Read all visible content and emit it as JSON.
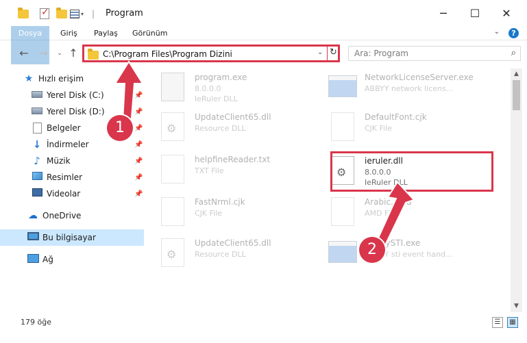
{
  "window": {
    "title": "Program",
    "minimize": "─",
    "maximize": "☐",
    "close": "✕"
  },
  "ribbon": {
    "tabs": [
      "Dosya",
      "Giriş",
      "Paylaş",
      "Görünüm"
    ]
  },
  "address": {
    "path": "C:\\Program Files\\Program Dizini",
    "search_placeholder": "Ara: Program"
  },
  "sidebar": {
    "quick_access": "Hızlı erişim",
    "items": [
      {
        "label": "Yerel Disk (C:)",
        "icon": "disk-icon"
      },
      {
        "label": "Yerel Disk (D:)",
        "icon": "disk-icon"
      },
      {
        "label": "Belgeler",
        "icon": "documents-icon"
      },
      {
        "label": "İndirmeler",
        "icon": "downloads-icon"
      },
      {
        "label": "Müzik",
        "icon": "music-icon"
      },
      {
        "label": "Resimler",
        "icon": "pictures-icon"
      },
      {
        "label": "Videolar",
        "icon": "videos-icon"
      }
    ],
    "onedrive": "OneDrive",
    "this_pc": "Bu bilgisayar",
    "network": "Ağ"
  },
  "files": [
    {
      "name": "program.exe",
      "line1": "8.0.0.0",
      "line2": "IeRuler DLL",
      "type": "exe"
    },
    {
      "name": "NetworkLicenseServer.exe",
      "line1": "ABBYY network licens...",
      "line2": "",
      "type": "app"
    },
    {
      "name": "UpdateClient65.dll",
      "line1": "Resource DLL",
      "line2": "",
      "type": "dll"
    },
    {
      "name": "DefaultFont.cjk",
      "line1": "CJK File",
      "line2": "",
      "type": "doc"
    },
    {
      "name": "helpfineReader.txt",
      "line1": "TXT File",
      "line2": "",
      "type": "doc"
    },
    {
      "name": "ieruler.dll",
      "line1": "8.0.0.0",
      "line2": "IeRuler DLL",
      "type": "dll"
    },
    {
      "name": "FastNrml.cjk",
      "line1": "CJK File",
      "line2": "",
      "type": "doc"
    },
    {
      "name": "Arabic.amd",
      "line1": "AMD File",
      "line2": "",
      "type": "doc"
    },
    {
      "name": "UpdateClient65.dll",
      "line1": "Resource DLL",
      "line2": "",
      "type": "dll"
    },
    {
      "name": "AbbyySTI.exe",
      "line1": "ABBYY sti event hand...",
      "line2": "",
      "type": "app"
    }
  ],
  "status": {
    "count": "179 öğe"
  },
  "annotations": {
    "step1": "1",
    "step2": "2"
  },
  "colors": {
    "accent": "#1979ca",
    "highlight": "#d9364b",
    "selection": "#cce8ff"
  }
}
